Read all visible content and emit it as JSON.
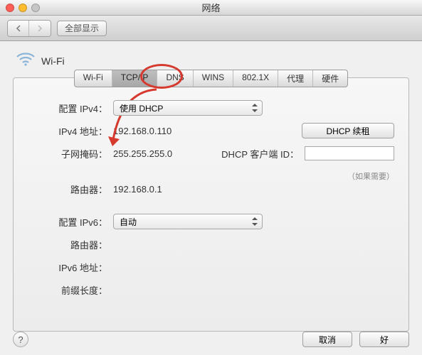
{
  "window": {
    "title": "网络"
  },
  "toolbar": {
    "show_all": "全部显示"
  },
  "header": {
    "wifi_label": "Wi-Fi"
  },
  "tabs": {
    "wifi": "Wi-Fi",
    "tcpip": "TCP/IP",
    "dns": "DNS",
    "wins": "WINS",
    "8021x": "802.1X",
    "proxy": "代理",
    "hardware": "硬件"
  },
  "ipv4": {
    "configure_label": "配置 IPv4：",
    "configure_value": "使用 DHCP",
    "address_label": "IPv4 地址：",
    "address_value": "192.168.0.110",
    "subnet_label": "子网掩码：",
    "subnet_value": "255.255.255.0",
    "router_label": "路由器：",
    "router_value": "192.168.0.1"
  },
  "dhcp": {
    "renew_label": "DHCP 续租",
    "client_id_label": "DHCP 客户端 ID：",
    "client_id_value": "",
    "hint": "（如果需要）"
  },
  "ipv6": {
    "configure_label": "配置 IPv6：",
    "configure_value": "自动",
    "router_label": "路由器：",
    "address_label": "IPv6 地址：",
    "prefix_label": "前缀长度："
  },
  "footer": {
    "help": "?",
    "cancel": "取消",
    "ok": "好"
  }
}
